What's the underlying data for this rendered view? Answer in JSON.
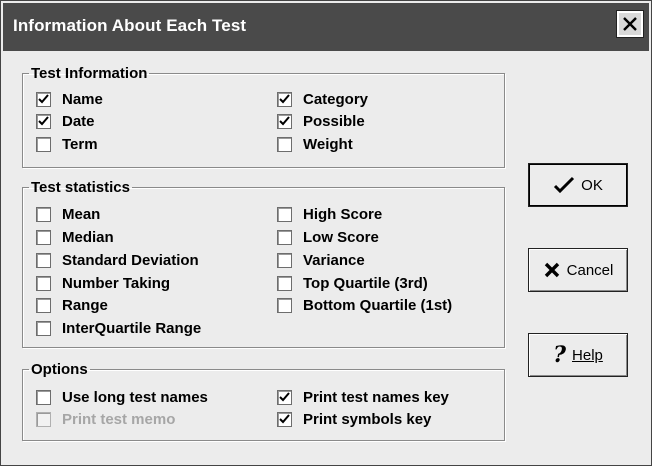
{
  "window": {
    "title": "Information About Each Test"
  },
  "test_information": {
    "legend": "Test Information",
    "items": [
      {
        "label": "Name",
        "checked": true
      },
      {
        "label": "Date",
        "checked": true
      },
      {
        "label": "Term",
        "checked": false
      },
      {
        "label": "Category",
        "checked": true
      },
      {
        "label": "Possible",
        "checked": true
      },
      {
        "label": "Weight",
        "checked": false
      }
    ]
  },
  "test_statistics": {
    "legend": "Test statistics",
    "items": [
      {
        "label": "Mean",
        "checked": false
      },
      {
        "label": "Median",
        "checked": false
      },
      {
        "label": "Standard Deviation",
        "checked": false
      },
      {
        "label": "Number Taking",
        "checked": false
      },
      {
        "label": "Range",
        "checked": false
      },
      {
        "label": "InterQuartile Range",
        "checked": false
      },
      {
        "label": "High Score",
        "checked": false
      },
      {
        "label": "Low Score",
        "checked": false
      },
      {
        "label": "Variance",
        "checked": false
      },
      {
        "label": "Top Quartile (3rd)",
        "checked": false
      },
      {
        "label": "Bottom Quartile (1st)",
        "checked": false
      }
    ]
  },
  "options": {
    "legend": "Options",
    "items": [
      {
        "label": "Use long test names",
        "checked": false,
        "disabled": false
      },
      {
        "label": "Print test memo",
        "checked": false,
        "disabled": true
      },
      {
        "label": "Print test names key",
        "checked": true,
        "disabled": false
      },
      {
        "label": "Print symbols key",
        "checked": true,
        "disabled": false
      }
    ]
  },
  "buttons": {
    "ok_label": "OK",
    "cancel_label": "Cancel",
    "help_label": "Help"
  },
  "icons": {
    "ok": "checkmark-icon",
    "cancel": "x-icon",
    "help": "question-mark-icon",
    "close": "close-icon"
  }
}
